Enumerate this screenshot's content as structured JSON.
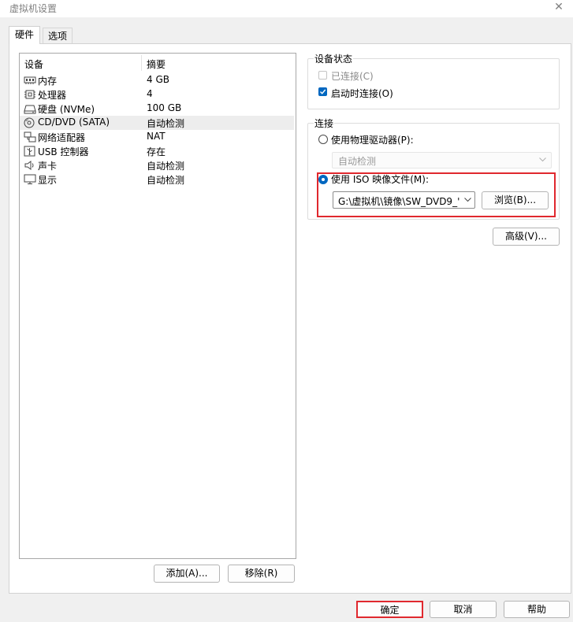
{
  "window": {
    "title": "虚拟机设置",
    "close_glyph": "✕"
  },
  "tabs": [
    {
      "label": "硬件"
    },
    {
      "label": "选项"
    }
  ],
  "device_list": {
    "headers": {
      "device": "设备",
      "summary": "摘要"
    },
    "rows": [
      {
        "name": "内存",
        "summary": "4 GB",
        "icon": "memory-icon"
      },
      {
        "name": "处理器",
        "summary": "4",
        "icon": "processor-icon"
      },
      {
        "name": "硬盘 (NVMe)",
        "summary": "100 GB",
        "icon": "hard-disk-icon"
      },
      {
        "name": "CD/DVD (SATA)",
        "summary": "自动检测",
        "icon": "cd-dvd-icon",
        "selected": true
      },
      {
        "name": "网络适配器",
        "summary": "NAT",
        "icon": "network-adapter-icon"
      },
      {
        "name": "USB 控制器",
        "summary": "存在",
        "icon": "usb-controller-icon"
      },
      {
        "name": "声卡",
        "summary": "自动检测",
        "icon": "sound-card-icon"
      },
      {
        "name": "显示",
        "summary": "自动检测",
        "icon": "display-icon"
      }
    ],
    "add_button": "添加(A)...",
    "remove_button": "移除(R)"
  },
  "device_status": {
    "title": "设备状态",
    "connected": {
      "label": "已连接(C)",
      "checked": false,
      "enabled": false
    },
    "connect_at_power_on": {
      "label": "启动时连接(O)",
      "checked": true
    }
  },
  "connection": {
    "title": "连接",
    "physical_drive": {
      "label": "使用物理驱动器(P):",
      "selected": false
    },
    "physical_drive_select": {
      "value": "自动检测",
      "enabled": false
    },
    "iso_image": {
      "label": "使用 ISO 映像文件(M):",
      "selected": true
    },
    "iso_path": {
      "value": "G:\\虚拟机\\镜像\\SW_DVD9_'"
    },
    "browse_button": "浏览(B)..."
  },
  "advanced_button": "高级(V)...",
  "footer": {
    "ok": "确定",
    "cancel": "取消",
    "help": "帮助"
  },
  "colors": {
    "accent": "#0067c0",
    "highlight_border": "#e0282e",
    "selected_row": "#ededed"
  }
}
